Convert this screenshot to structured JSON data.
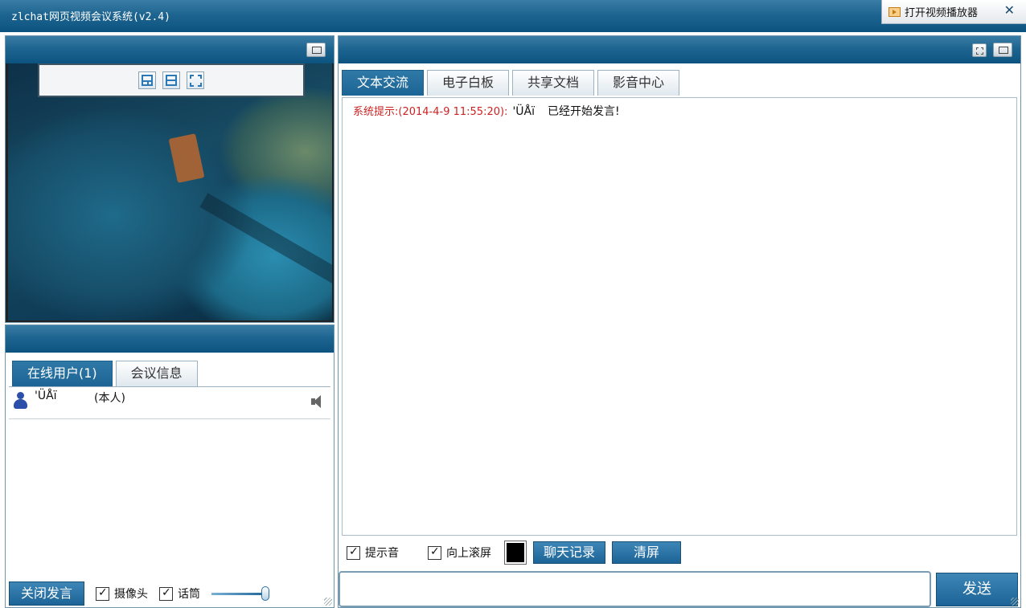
{
  "app": {
    "title": "zlchat网页视频会议系统(v2.4)",
    "open_player_label": "打开视频播放器",
    "close_symbol": "✕"
  },
  "video_panel": {
    "toolbar_icons": [
      "layout-grid-icon",
      "layout-rows-icon",
      "fullscreen-icon"
    ]
  },
  "users_panel": {
    "tabs": [
      {
        "label": "在线用户(1)",
        "active": true
      },
      {
        "label": "会议信息",
        "active": false
      }
    ],
    "users": [
      {
        "name": "'ÜÅï",
        "self_label": "(本人)"
      }
    ],
    "footer": {
      "close_speak_label": "关闭发言",
      "camera_label": "摄像头",
      "camera_checked": true,
      "mic_label": "话筒",
      "mic_checked": true,
      "volume_level": 1.0
    }
  },
  "chat_panel": {
    "tabs": [
      {
        "label": "文本交流",
        "active": true
      },
      {
        "label": "电子白板",
        "active": false
      },
      {
        "label": "共享文档",
        "active": false
      },
      {
        "label": "影音中心",
        "active": false
      }
    ],
    "messages": [
      {
        "prefix": "系统提示:",
        "time": "(2014-4-9 11:55:20):",
        "user": "'ÜÅï",
        "text": "已经开始发言!"
      }
    ],
    "tools": {
      "sound_label": "提示音",
      "sound_checked": true,
      "scroll_label": "向上滚屏",
      "scroll_checked": true,
      "font_color": "#000000",
      "history_label": "聊天记录",
      "clear_label": "清屏"
    },
    "input_value": "",
    "send_label": "发送"
  },
  "colors": {
    "accent_blue": "#1d6590",
    "system_red": "#cc2222"
  }
}
